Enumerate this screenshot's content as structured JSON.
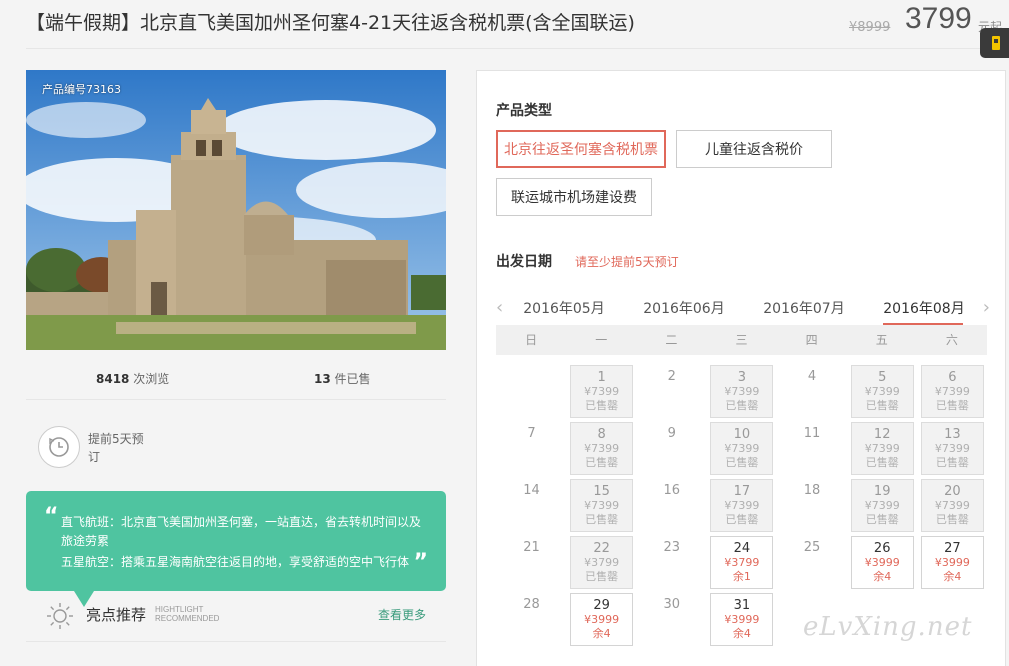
{
  "header": {
    "title": "【端午假期】北京直飞美国加州圣何塞4-21天往返含税机票(含全国联运)",
    "old_price": "¥8999",
    "price": "3799",
    "price_suffix": "元起"
  },
  "product": {
    "id_label": "产品编号73163",
    "views_count": "8418",
    "views_label": "次浏览",
    "sold_count": "13",
    "sold_label": "件已售",
    "advance_text": "提前5天预订"
  },
  "quote": {
    "open": "“",
    "line1": "直飞航班：北京直飞美国加州圣何塞，一站直达，省去转机时间以及旅途劳累",
    "line2": "五星航空：搭乘五星海南航空往返目的地，享受舒适的空中飞行体",
    "close": "”"
  },
  "highlights": {
    "title": "亮点推荐",
    "en1": "HIGHTLIGHT",
    "en2": "RECOMMENDED",
    "more": "查看更多"
  },
  "panel": {
    "type_title": "产品类型",
    "options": [
      {
        "label": "北京往返圣何塞含税机票",
        "active": true
      },
      {
        "label": "儿童往返含税价",
        "active": false
      },
      {
        "label": "联运城市机场建设费",
        "active": false
      }
    ],
    "date_title": "出发日期",
    "date_tip": "请至少提前5天预订",
    "prev_arrow": "‹",
    "next_arrow": "›",
    "months": [
      "2016年05月",
      "2016年06月",
      "2016年07月",
      "2016年08月"
    ],
    "active_month": 3,
    "weekdays": [
      "日",
      "一",
      "二",
      "三",
      "四",
      "五",
      "六"
    ]
  },
  "calendar": [
    [
      null,
      {
        "d": "1",
        "p": "¥7399",
        "s": "已售罄",
        "st": "sold"
      },
      {
        "d": "2"
      },
      {
        "d": "3",
        "p": "¥7399",
        "s": "已售罄",
        "st": "sold"
      },
      {
        "d": "4"
      },
      {
        "d": "5",
        "p": "¥7399",
        "s": "已售罄",
        "st": "sold"
      },
      {
        "d": "6",
        "p": "¥7399",
        "s": "已售罄",
        "st": "sold"
      }
    ],
    [
      {
        "d": "7"
      },
      {
        "d": "8",
        "p": "¥7399",
        "s": "已售罄",
        "st": "sold"
      },
      {
        "d": "9"
      },
      {
        "d": "10",
        "p": "¥7399",
        "s": "已售罄",
        "st": "sold"
      },
      {
        "d": "11"
      },
      {
        "d": "12",
        "p": "¥7399",
        "s": "已售罄",
        "st": "sold"
      },
      {
        "d": "13",
        "p": "¥7399",
        "s": "已售罄",
        "st": "sold"
      }
    ],
    [
      {
        "d": "14"
      },
      {
        "d": "15",
        "p": "¥7399",
        "s": "已售罄",
        "st": "sold"
      },
      {
        "d": "16"
      },
      {
        "d": "17",
        "p": "¥7399",
        "s": "已售罄",
        "st": "sold"
      },
      {
        "d": "18"
      },
      {
        "d": "19",
        "p": "¥7399",
        "s": "已售罄",
        "st": "sold"
      },
      {
        "d": "20",
        "p": "¥7399",
        "s": "已售罄",
        "st": "sold"
      }
    ],
    [
      {
        "d": "21"
      },
      {
        "d": "22",
        "p": "¥3799",
        "s": "已售罄",
        "st": "sold"
      },
      {
        "d": "23"
      },
      {
        "d": "24",
        "p": "¥3799",
        "s": "余1",
        "st": "avail"
      },
      {
        "d": "25"
      },
      {
        "d": "26",
        "p": "¥3999",
        "s": "余4",
        "st": "avail"
      },
      {
        "d": "27",
        "p": "¥3999",
        "s": "余4",
        "st": "avail"
      }
    ],
    [
      {
        "d": "28"
      },
      {
        "d": "29",
        "p": "¥3999",
        "s": "余4",
        "st": "avail"
      },
      {
        "d": "30"
      },
      {
        "d": "31",
        "p": "¥3999",
        "s": "余4",
        "st": "avail"
      },
      null,
      null,
      null
    ]
  ],
  "watermark": "eLvXing.net",
  "colors": {
    "accent": "#e0685a",
    "quote_bg": "#4fc4a0",
    "link": "#3a9b7c"
  }
}
